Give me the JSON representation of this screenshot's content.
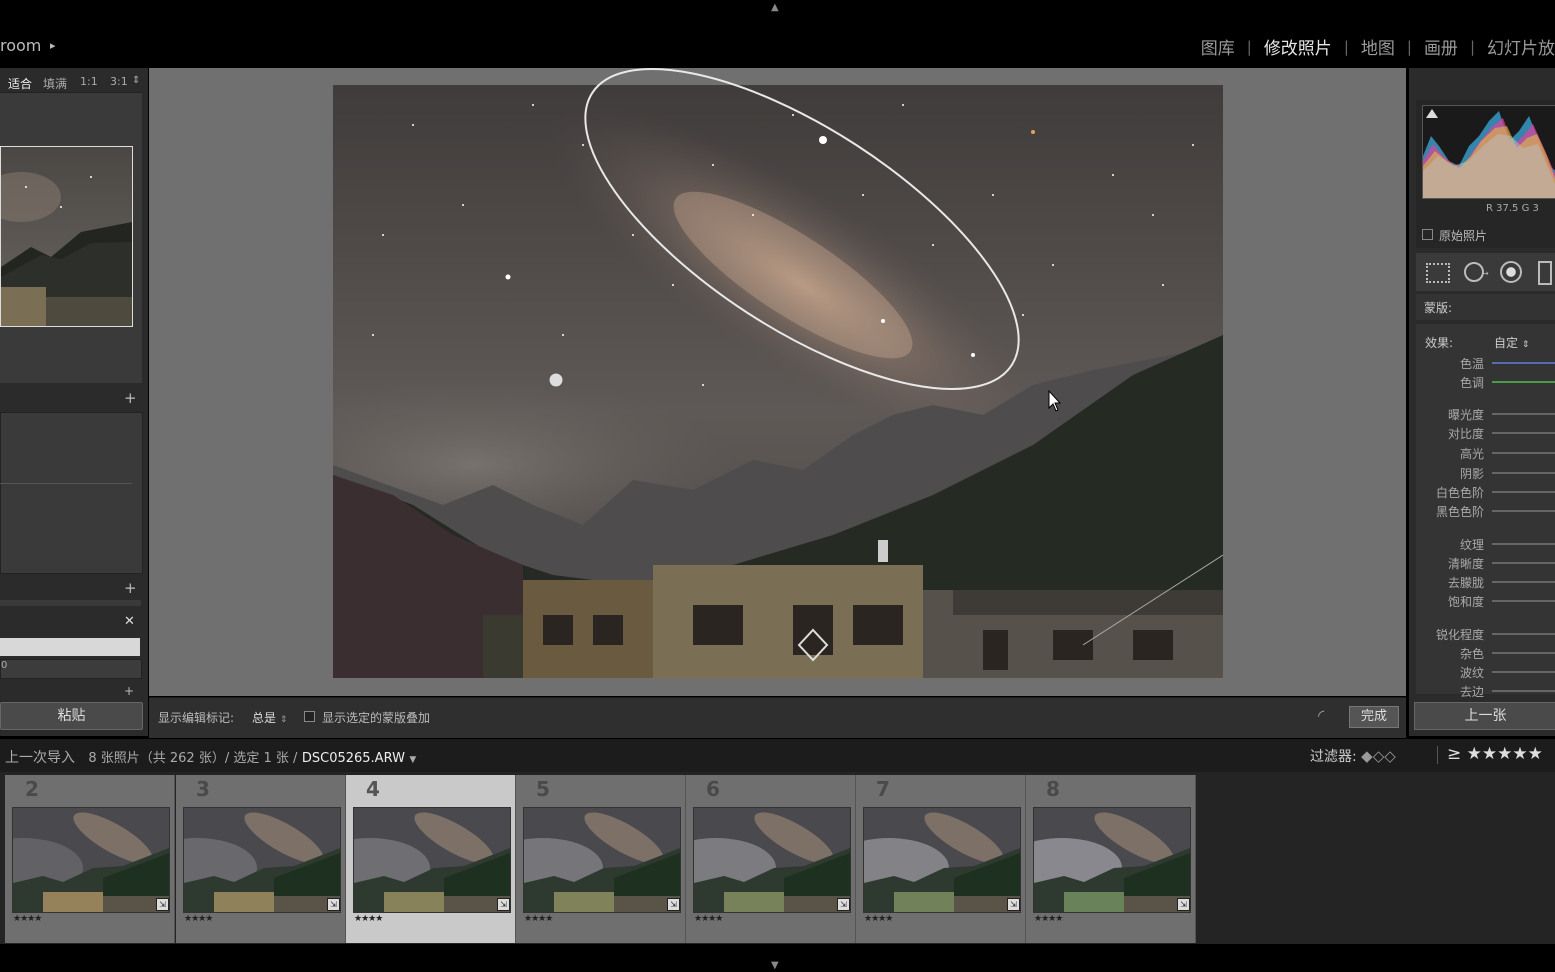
{
  "app": {
    "title": "room",
    "title_arrow": "▸"
  },
  "modules": [
    {
      "label": "图库",
      "active": false
    },
    {
      "label": "修改照片",
      "active": true
    },
    {
      "label": "地图",
      "active": false
    },
    {
      "label": "画册",
      "active": false
    },
    {
      "label": "幻灯片放",
      "active": false
    }
  ],
  "navigator": {
    "zoom_options": [
      "适合",
      "填满",
      "1:1",
      "3:1"
    ],
    "zoom_dropdown": "⇕"
  },
  "left_panel": {
    "plus_icon": "+",
    "close_icon": "✕",
    "field_value": "0",
    "paste_label": "粘贴"
  },
  "toolbar": {
    "show_edit_pins_label": "显示编辑标记:",
    "show_edit_pins_value": "总是",
    "overlay_label": "显示选定的蒙版叠加",
    "done_label": "完成"
  },
  "right_panel": {
    "rgb_readout": "R  37.5   G  3",
    "original_photo_label": "原始照片",
    "mask_label": "蒙版:",
    "effect_label": "效果:",
    "effect_value": "自定",
    "sliders": [
      {
        "label": "色温",
        "color": "#5a6ab0"
      },
      {
        "label": "色调",
        "color": "#4a9a4a"
      },
      {
        "label": "曝光度",
        "color": "#666666"
      },
      {
        "label": "对比度",
        "color": "#666666"
      },
      {
        "label": "高光",
        "color": "#666666"
      },
      {
        "label": "阴影",
        "color": "#666666"
      },
      {
        "label": "白色色阶",
        "color": "#666666"
      },
      {
        "label": "黑色色阶",
        "color": "#666666"
      },
      {
        "label": "纹理",
        "color": "#666666"
      },
      {
        "label": "清晰度",
        "color": "#666666"
      },
      {
        "label": "去朦胧",
        "color": "#666666"
      },
      {
        "label": "饱和度",
        "color": "#666666"
      },
      {
        "label": "锐化程度",
        "color": "#666666"
      },
      {
        "label": "杂色",
        "color": "#666666"
      },
      {
        "label": "波纹",
        "color": "#666666"
      },
      {
        "label": "去边",
        "color": "#666666"
      }
    ],
    "prev_button": "上一张"
  },
  "filmstrip_header": {
    "source": "上一次导入",
    "count": "8 张照片（共 262 张）/ 选定 1 张 /",
    "filename": "DSC05265.ARW",
    "filter_label": "过滤器:",
    "filter_flags": "◆◇◇",
    "rating_filter": "≥ ★★★★★"
  },
  "filmstrip": [
    {
      "num": "2",
      "stars": "★★★★",
      "selected": false
    },
    {
      "num": "3",
      "stars": "★★★★",
      "selected": false
    },
    {
      "num": "4",
      "stars": "★★★★",
      "selected": true
    },
    {
      "num": "5",
      "stars": "★★★★",
      "selected": false
    },
    {
      "num": "6",
      "stars": "★★★★",
      "selected": false
    },
    {
      "num": "7",
      "stars": "★★★★",
      "selected": false
    },
    {
      "num": "8",
      "stars": "★★★★",
      "selected": false
    }
  ],
  "colors": {
    "panel_bg": "#2b2b2b",
    "canvas_bg": "#707070",
    "selected_cell": "#c9c9c9"
  }
}
